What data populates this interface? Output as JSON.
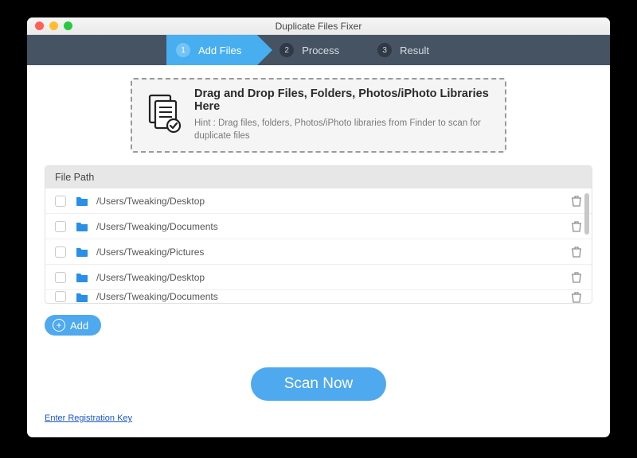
{
  "window": {
    "title": "Duplicate Files Fixer"
  },
  "steps": [
    {
      "num": "1",
      "label": "Add Files",
      "active": true
    },
    {
      "num": "2",
      "label": "Process",
      "active": false
    },
    {
      "num": "3",
      "label": "Result",
      "active": false
    }
  ],
  "dropzone": {
    "title": "Drag and Drop Files, Folders, Photos/iPhoto Libraries Here",
    "hint": "Hint : Drag files, folders, Photos/iPhoto libraries from Finder to scan for duplicate files"
  },
  "filepath": {
    "header": "File Path",
    "rows": [
      {
        "path": "/Users/Tweaking/Desktop"
      },
      {
        "path": "/Users/Tweaking/Documents"
      },
      {
        "path": "/Users/Tweaking/Pictures"
      },
      {
        "path": "/Users/Tweaking/Desktop"
      },
      {
        "path": "/Users/Tweaking/Documents"
      }
    ]
  },
  "buttons": {
    "add": "Add",
    "scan": "Scan Now"
  },
  "links": {
    "registration": "Enter Registration Key"
  },
  "colors": {
    "accent": "#4ea9ee",
    "stepbar": "#455363"
  }
}
